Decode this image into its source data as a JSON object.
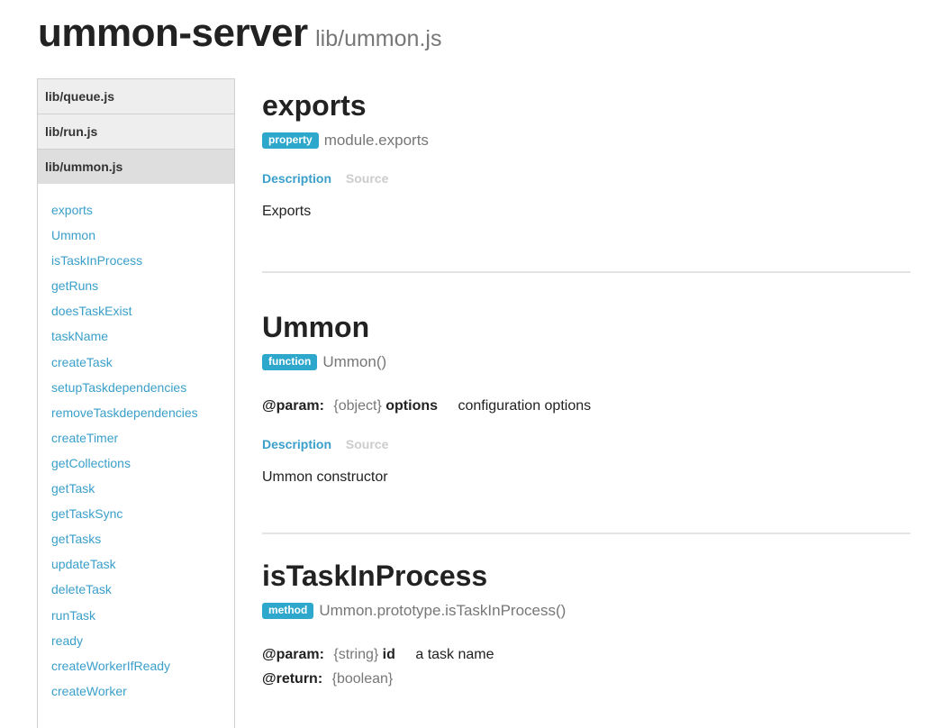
{
  "header": {
    "title": "ummon-server",
    "subtitle": "lib/ummon.js"
  },
  "sidebar": {
    "files": [
      {
        "label": "lib/queue.js"
      },
      {
        "label": "lib/run.js"
      },
      {
        "label": "lib/ummon.js",
        "active": true
      }
    ],
    "items": [
      "exports",
      "Ummon",
      "isTaskInProcess",
      "getRuns",
      "doesTaskExist",
      "taskName",
      "createTask",
      "setupTaskdependencies",
      "removeTaskdependencies",
      "createTimer",
      "getCollections",
      "getTask",
      "getTaskSync",
      "getTasks",
      "updateTask",
      "deleteTask",
      "runTask",
      "ready",
      "createWorkerIfReady",
      "createWorker"
    ]
  },
  "tabs": {
    "description": "Description",
    "source": "Source"
  },
  "sections": [
    {
      "title": "exports",
      "badge": "property",
      "signature": "module.exports",
      "description": "Exports"
    },
    {
      "title": "Ummon",
      "badge": "function",
      "signature": "Ummon()",
      "params": [
        {
          "label": "@param:",
          "type": "{object}",
          "name": "options",
          "desc": "configuration options"
        }
      ],
      "description": "Ummon constructor"
    },
    {
      "title": "isTaskInProcess",
      "badge": "method",
      "signature": "Ummon.prototype.isTaskInProcess()",
      "params": [
        {
          "label": "@param:",
          "type": "{string}",
          "name": "id",
          "desc": "a task name"
        }
      ],
      "returns": {
        "label": "@return:",
        "type": "{boolean}"
      }
    }
  ],
  "colors": {
    "accent": "#2ea7cd",
    "link": "#3a9fca",
    "inactive_tab": "#cccccc"
  }
}
